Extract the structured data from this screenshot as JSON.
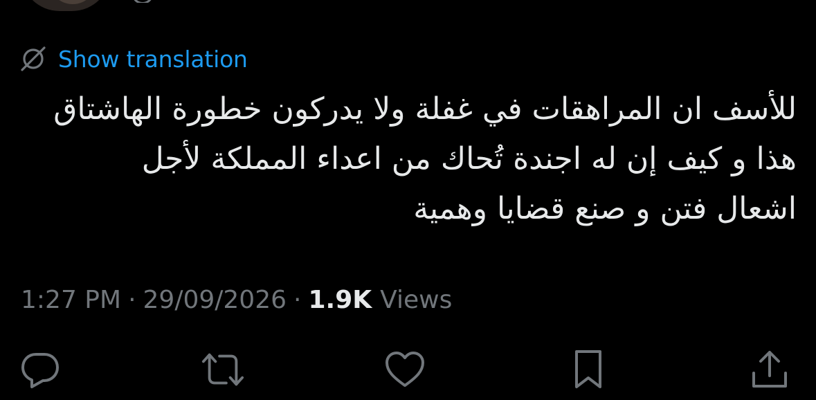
{
  "translation": {
    "label": "Show translation",
    "icon": "no-translation-icon",
    "color": "#1d9bf0"
  },
  "tweet": {
    "lines": [
      "للأسف ان المراهقات في غفلة ولا يدركون خطورة الهاشتاق",
      "هذا و كيف إن له اجندة تُحاك من اعداء المملكة لأجل",
      "اشعال فتن و صنع قضايا وهمية"
    ]
  },
  "meta": {
    "time": "1:27 PM",
    "separator": "·",
    "date": "29/09/2026",
    "views_count": "1.9K",
    "views_label": "Views"
  },
  "actions": [
    {
      "name": "reply",
      "icon": "reply-icon"
    },
    {
      "name": "retweet",
      "icon": "retweet-icon"
    },
    {
      "name": "like",
      "icon": "heart-icon"
    },
    {
      "name": "bookmark",
      "icon": "bookmark-icon"
    },
    {
      "name": "share",
      "icon": "share-icon"
    }
  ],
  "colors": {
    "background": "#000000",
    "text": "#e7e9ea",
    "muted": "#71767b",
    "accent": "#1d9bf0"
  }
}
